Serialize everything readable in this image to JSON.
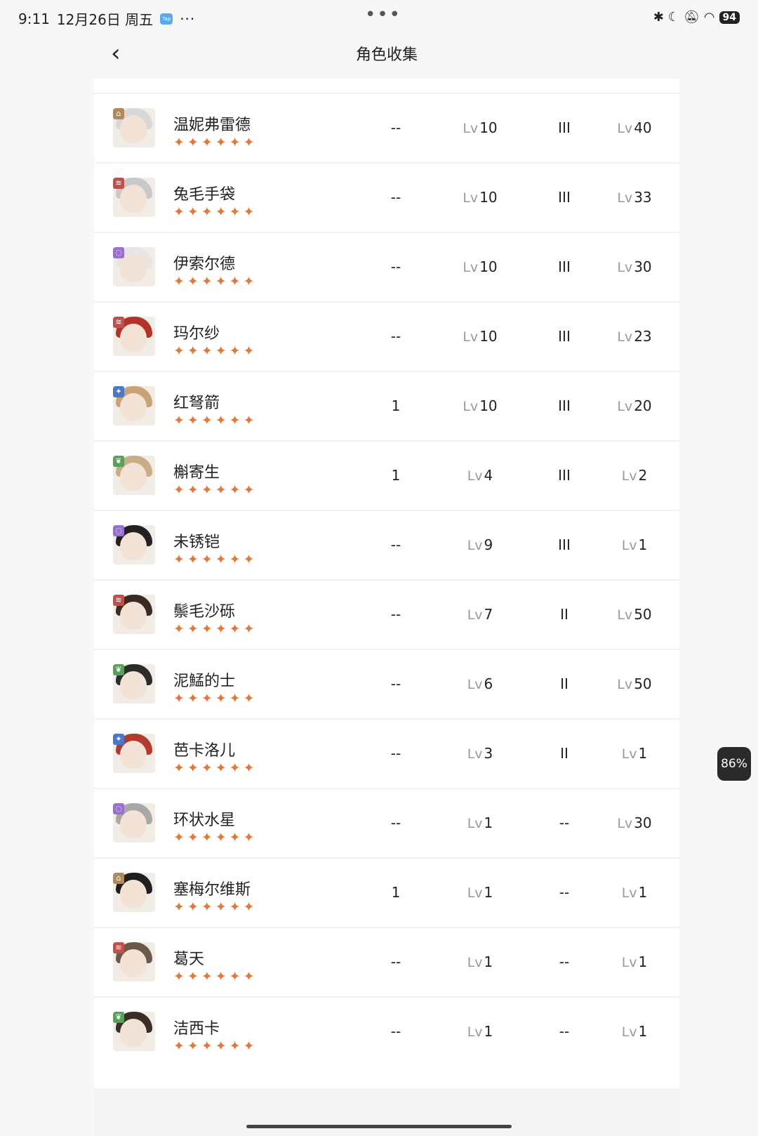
{
  "status": {
    "time": "9:11",
    "date": "12月26日 周五",
    "app_badge": "Tap",
    "more": "···",
    "center_dots": "•••",
    "battery": "94"
  },
  "header": {
    "back": "‹",
    "title": "角色收集"
  },
  "level_prefix": "Lv",
  "star_glyphs": "✦✦✦✦✦✦",
  "floating_badge": "86%",
  "rows": [
    {
      "name": "温妮弗雷德",
      "element": "bag",
      "element_color": "#b08a5a",
      "col1": "--",
      "col2": "10",
      "col3": "III",
      "col4": "40"
    },
    {
      "name": "兔毛手袋",
      "element": "beast",
      "element_color": "#c0504d",
      "col1": "--",
      "col2": "10",
      "col3": "III",
      "col4": "33"
    },
    {
      "name": "伊索尔德",
      "element": "spirit",
      "element_color": "#9a6fd0",
      "col1": "--",
      "col2": "10",
      "col3": "III",
      "col4": "30"
    },
    {
      "name": "玛尔纱",
      "element": "beast",
      "element_color": "#c0504d",
      "col1": "--",
      "col2": "10",
      "col3": "III",
      "col4": "23"
    },
    {
      "name": "红弩箭",
      "element": "star",
      "element_color": "#4a78c9",
      "col1": "1",
      "col2": "10",
      "col3": "III",
      "col4": "20"
    },
    {
      "name": "槲寄生",
      "element": "plant",
      "element_color": "#5aa05a",
      "col1": "1",
      "col2": "4",
      "col3": "III",
      "col4": "2"
    },
    {
      "name": "未锈铠",
      "element": "spirit",
      "element_color": "#9a6fd0",
      "col1": "--",
      "col2": "9",
      "col3": "III",
      "col4": "1"
    },
    {
      "name": "鬃毛沙砾",
      "element": "beast",
      "element_color": "#c0504d",
      "col1": "--",
      "col2": "7",
      "col3": "II",
      "col4": "50"
    },
    {
      "name": "泥鯭的士",
      "element": "plant",
      "element_color": "#5aa05a",
      "col1": "--",
      "col2": "6",
      "col3": "II",
      "col4": "50"
    },
    {
      "name": "芭卡洛儿",
      "element": "star",
      "element_color": "#4a78c9",
      "col1": "--",
      "col2": "3",
      "col3": "II",
      "col4": "1"
    },
    {
      "name": "环状水星",
      "element": "spirit",
      "element_color": "#9a6fd0",
      "col1": "--",
      "col2": "1",
      "col3": "--",
      "col4": "30"
    },
    {
      "name": "塞梅尔维斯",
      "element": "bag",
      "element_color": "#b08a5a",
      "col1": "1",
      "col2": "1",
      "col3": "--",
      "col4": "1"
    },
    {
      "name": "葛天",
      "element": "beast",
      "element_color": "#c0504d",
      "col1": "--",
      "col2": "1",
      "col3": "--",
      "col4": "1"
    },
    {
      "name": "洁西卡",
      "element": "plant",
      "element_color": "#5aa05a",
      "col1": "--",
      "col2": "1",
      "col3": "--",
      "col4": "1"
    }
  ]
}
